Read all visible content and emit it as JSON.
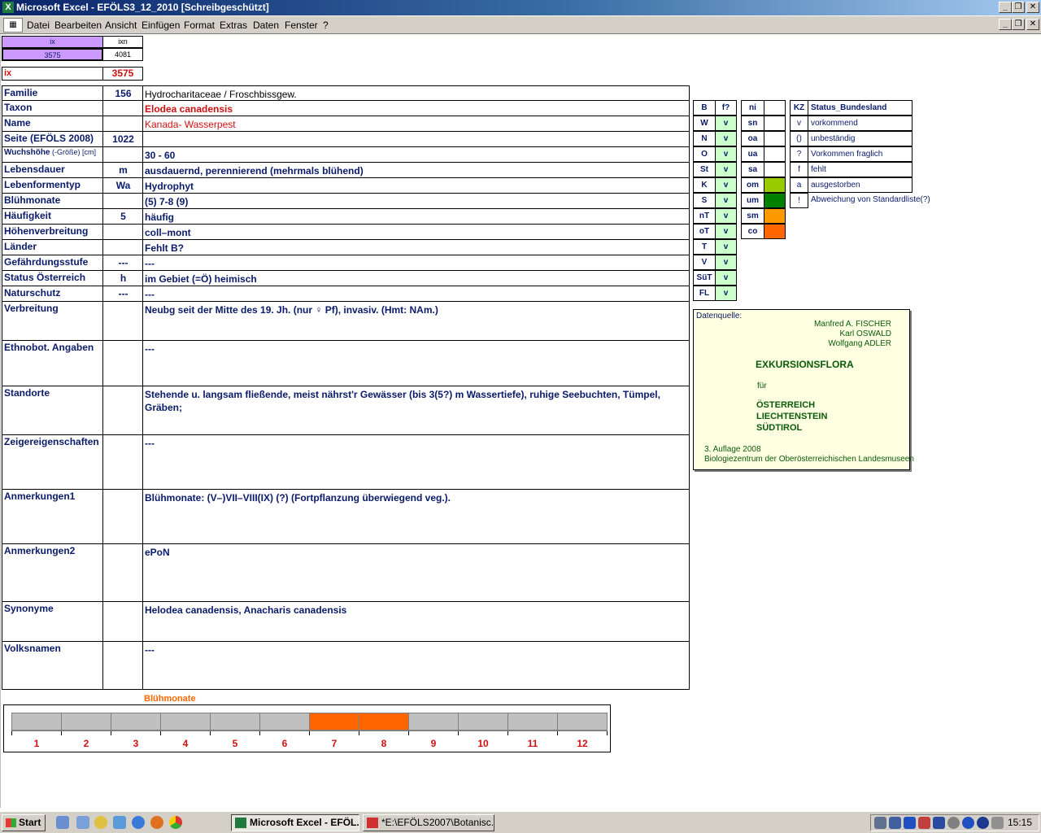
{
  "window": {
    "title": "Microsoft Excel - EFÖLS3_12_2010  [Schreibgeschützt]",
    "app_icon": "excel-icon",
    "controls": [
      "_",
      "❐",
      "✕"
    ]
  },
  "menu": {
    "items": [
      "Datei",
      "Bearbeiten",
      "Ansicht",
      "Einfügen",
      "Format",
      "Extras",
      "Daten",
      "Fenster",
      "?"
    ]
  },
  "index": {
    "ix_header": "ix",
    "ixn_header": "ixn",
    "ix_value": "3575",
    "ixn_value": "4081",
    "ix_label": "ix",
    "ix_big": "3575"
  },
  "rows": [
    {
      "label": "Familie",
      "code": "156",
      "value": "Hydrocharitaceae  /  Froschbissgew."
    },
    {
      "label": "Taxon",
      "code": "",
      "value": "Elodea canadensis"
    },
    {
      "label": "Name",
      "code": "",
      "value": "Kanada- Wasserpest"
    },
    {
      "label": "Seite (EFÖLS 2008)",
      "code": "1022",
      "value": ""
    },
    {
      "label": "Wuchshöhe",
      "label_suffix": " (-Größe) [cm]",
      "code": "",
      "value": " 30 - 60"
    },
    {
      "label": "Lebensdauer",
      "code": "m",
      "value": "ausdauernd, perennierend (mehrmals blühend)"
    },
    {
      "label": "Lebenformentyp",
      "code": "Wa",
      "value": "Hydrophyt"
    },
    {
      "label": "Blühmonate",
      "code": "",
      "value": "(5) 7-8 (9)"
    },
    {
      "label": "Häufigkeit",
      "code": "5",
      "value": "häufig"
    },
    {
      "label": "Höhenverbreitung",
      "code": "",
      "value": "coll–mont"
    },
    {
      "label": "Länder",
      "code": "",
      "value": "Fehlt B?"
    },
    {
      "label": "Gefährdungsstufe",
      "code": "---",
      "value": "  ---"
    },
    {
      "label": "Status Österreich",
      "code": "h",
      "value": "im Gebiet (=Ö) heimisch"
    },
    {
      "label": "Naturschutz",
      "code": "---",
      "value": " ---"
    },
    {
      "label": "Verbreitung",
      "code": "",
      "value": "Neubg seit der Mitte des 19. Jh. (nur ♀ Pf), invasiv. (Hmt: NAm.)"
    },
    {
      "label": "Ethnobot. Angaben",
      "code": "",
      "value": "---"
    },
    {
      "label": "Standorte",
      "code": "",
      "value": "Stehende u. langsam fließende, meist nährst'r Gewässer (bis 3(5?) m Wassertiefe), ruhige Seebuchten, Tümpel, Gräben;"
    },
    {
      "label": "Zeigereigenschaften",
      "code": "",
      "value": "---"
    },
    {
      "label": "Anmerkungen1",
      "code": "",
      "value": "Blühmonate: (V–)VII–VIII(IX) (?) (Fortpflanzung überwiegend veg.)."
    },
    {
      "label": "Anmerkungen2",
      "code": "",
      "value": "ePoN"
    },
    {
      "label": "Synonyme",
      "code": "",
      "value": "Helodea canadensis, Anacharis canadensis"
    },
    {
      "label": "Volksnamen",
      "code": "",
      "value": "---"
    }
  ],
  "regions": {
    "header": [
      "B",
      "f?"
    ],
    "items": [
      {
        "code": "W",
        "val": "v"
      },
      {
        "code": "N",
        "val": "v"
      },
      {
        "code": "O",
        "val": "v"
      },
      {
        "code": "St",
        "val": "v"
      },
      {
        "code": "K",
        "val": "v"
      },
      {
        "code": "S",
        "val": "v"
      },
      {
        "code": "nT",
        "val": "v"
      },
      {
        "code": "oT",
        "val": "v"
      },
      {
        "code": "T",
        "val": "v"
      },
      {
        "code": "V",
        "val": "v"
      },
      {
        "code": "SüT",
        "val": "v"
      },
      {
        "code": "FL",
        "val": "v"
      }
    ]
  },
  "altitude": {
    "header": "ni",
    "items": [
      {
        "code": "sn",
        "color": "#ffffff"
      },
      {
        "code": "oa",
        "color": "#ffffff"
      },
      {
        "code": "ua",
        "color": "#ffffff"
      },
      {
        "code": "sa",
        "color": "#ffffff"
      },
      {
        "code": "om",
        "color": "#99cc00"
      },
      {
        "code": "um",
        "color": "#008000"
      },
      {
        "code": "sm",
        "color": "#ff9900"
      },
      {
        "code": "co",
        "color": "#ff6600"
      }
    ]
  },
  "status_legend": {
    "header_kz": "KZ",
    "header_text": "Status_Bundesland",
    "items": [
      {
        "kz": "v",
        "text": "vorkommend"
      },
      {
        "kz": "()",
        "text": "unbeständig"
      },
      {
        "kz": "?",
        "text": "Vorkommen fraglich"
      },
      {
        "kz": "f",
        "text": "fehlt"
      },
      {
        "kz": "a",
        "text": "ausgestorben"
      },
      {
        "kz": "!",
        "text": "Abweichung von Standardliste(?)"
      }
    ]
  },
  "source": {
    "label": "Datenquelle:",
    "author1": "Manfred A. FISCHER",
    "author2": "Karl OSWALD",
    "author3": "Wolfgang ADLER",
    "book": "EXKURSIONSFLORA",
    "for": "für",
    "country1": "ÖSTERREICH",
    "country2": "LIECHTENSTEIN",
    "country3": "SÜDTIROL",
    "edition": "3. Auflage 2008",
    "publisher": "Biologiezentrum der Oberösterreichischen Landesmuseen"
  },
  "bloom": {
    "title": "Blühmonate",
    "months": [
      "1",
      "2",
      "3",
      "4",
      "5",
      "6",
      "7",
      "8",
      "9",
      "10",
      "11",
      "12"
    ],
    "active": [
      false,
      false,
      false,
      false,
      false,
      false,
      true,
      true,
      false,
      false,
      false,
      false
    ],
    "active_color": "#ff6600",
    "inactive_color": "#c0c0c0"
  },
  "taskbar": {
    "start_label": "Start",
    "tasks": [
      {
        "label": "Microsoft Excel - EFÖL...",
        "icon": "excel-icon",
        "active": true
      },
      {
        "label": "*E:\\EFÖLS2007\\Botanisc...",
        "icon": "paint-icon",
        "active": false
      }
    ],
    "clock": "15:15"
  }
}
